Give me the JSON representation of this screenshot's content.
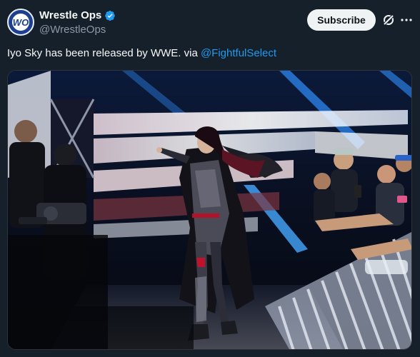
{
  "post": {
    "author": {
      "display_name": "Wrestle Ops",
      "handle": "@WrestleOps",
      "avatar_text": "WO",
      "verified": true
    },
    "actions": {
      "subscribe_label": "Subscribe",
      "grok_icon": "grok-icon",
      "more_icon": "more-icon"
    },
    "text": {
      "body": "Iyo Sky has been released by WWE. via ",
      "mention": "@FightfulSelect"
    },
    "media": {
      "kind": "photo"
    }
  },
  "colors": {
    "background": "#15202b",
    "text": "#f7f9f9",
    "secondary_text": "#8b98a5",
    "link": "#1d9bf0",
    "button_bg": "#eff3f4",
    "verified": "#1d9bf0"
  }
}
